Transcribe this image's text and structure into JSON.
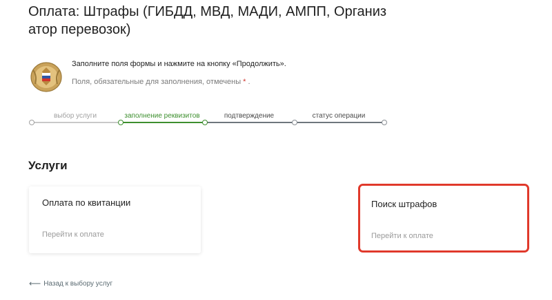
{
  "page": {
    "title": "Оплата: Штрафы (ГИБДД, МВД, МАДИ, АМПП, Организатор перевозок)"
  },
  "form_intro": {
    "instruction": "Заполните поля формы и нажмите на кнопку «Продолжить».",
    "required_note": "Поля, обязательные для заполнения, отмечены",
    "required_star": "*",
    "required_end": "."
  },
  "stepper": {
    "steps": [
      {
        "label": "выбор услуги",
        "state": "done"
      },
      {
        "label": "заполнение реквизитов",
        "state": "active"
      },
      {
        "label": "подтверждение",
        "state": "todo"
      },
      {
        "label": "статус операции",
        "state": "todo"
      }
    ],
    "colors": {
      "done": "#c8c8c8",
      "active": "#3d8f2e",
      "todo": "#6e767d"
    }
  },
  "services": {
    "title": "Услуги",
    "cards": [
      {
        "title": "Оплата по квитанции",
        "link": "Перейти к оплате",
        "highlighted": false
      },
      {
        "title": "Поиск штрафов",
        "link": "Перейти к оплате",
        "highlighted": true
      }
    ],
    "highlight_color": "#e0392b"
  },
  "back": {
    "icon": "arrow-left-icon",
    "label": "Назад к выбору услуг"
  }
}
